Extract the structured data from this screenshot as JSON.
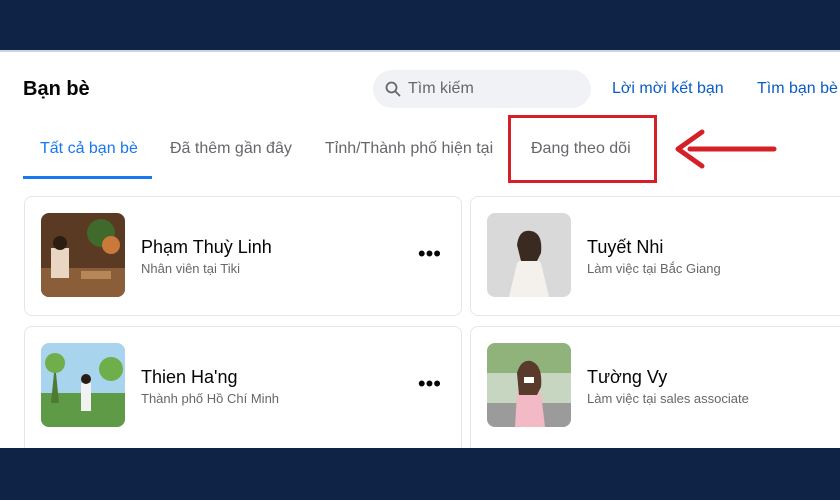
{
  "page": {
    "title": "Bạn bè"
  },
  "search": {
    "placeholder": "Tìm kiếm"
  },
  "header_links": {
    "friend_requests": "Lời mời kết bạn",
    "find_friends": "Tìm bạn bè"
  },
  "tabs": [
    {
      "label": "Tất cả bạn bè",
      "active": true
    },
    {
      "label": "Đã thêm gần đây",
      "active": false
    },
    {
      "label": "Tỉnh/Thành phố hiện tại",
      "active": false
    },
    {
      "label": "Đang theo dõi",
      "active": false
    }
  ],
  "friends": [
    {
      "name": "Phạm Thuỳ Linh",
      "subtitle": "Nhân viên tại Tiki",
      "more": "•••"
    },
    {
      "name": "Tuyết Nhi",
      "subtitle": "Làm việc tại Bắc Giang",
      "more": "•••"
    },
    {
      "name": "Thien Ha'ng",
      "subtitle": "Thành phố Hồ Chí Minh",
      "more": "•••"
    },
    {
      "name": "Tường Vy",
      "subtitle": "Làm việc tại sales associate",
      "more": "•••"
    }
  ],
  "colors": {
    "accent": "#1877f2",
    "link": "#0a5bc8",
    "highlight": "#d62027",
    "frame": "#0f2347"
  }
}
